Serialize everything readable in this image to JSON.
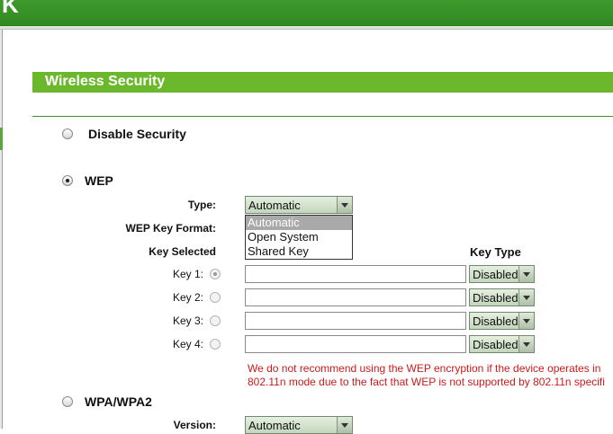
{
  "header": {
    "logo_glyph": "K"
  },
  "section": {
    "title": "Wireless Security"
  },
  "disable_security": {
    "label": "Disable Security",
    "selected": false
  },
  "wep": {
    "label": "WEP",
    "selected": true,
    "type_label": "Type:",
    "type_value": "Automatic",
    "type_options": [
      "Automatic",
      "Open System",
      "Shared Key"
    ],
    "key_format_label": "WEP Key Format:",
    "key_selected_header": "Key Selected",
    "key_type_header": "Key Type",
    "keys": [
      {
        "label": "Key 1:",
        "selected": true,
        "value": "",
        "type": "Disabled"
      },
      {
        "label": "Key 2:",
        "selected": false,
        "value": "",
        "type": "Disabled"
      },
      {
        "label": "Key 3:",
        "selected": false,
        "value": "",
        "type": "Disabled"
      },
      {
        "label": "Key 4:",
        "selected": false,
        "value": "",
        "type": "Disabled"
      }
    ],
    "warning_line1": "We do not recommend using the WEP encryption if the device operates in",
    "warning_line2": "802.11n mode due to the fact that WEP is not supported by 802.11n specifi"
  },
  "wpa": {
    "label": "WPA/WPA2",
    "selected": false,
    "version_label": "Version:",
    "version_value": "Automatic"
  },
  "colors": {
    "accent_green": "#6cb82c",
    "warning_red": "#cc1a1a"
  }
}
